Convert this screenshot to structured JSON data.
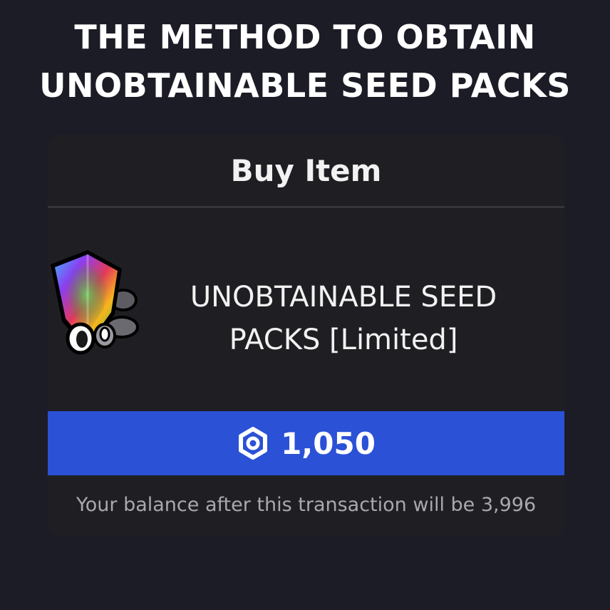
{
  "headline": {
    "line1": "THE METHOD TO OBTAIN",
    "line2": "UNOBTAINABLE SEED PACKS"
  },
  "modal": {
    "title": "Buy Item",
    "item": {
      "name_line1": "UNOBTAINABLE SEED",
      "name_line2": "PACKS [Limited]",
      "icon": "rainbow-shield-seed-pack-icon"
    },
    "buy_button": {
      "price": "1,050",
      "currency_icon": "robux-icon",
      "color": "#2a51d6"
    },
    "balance_text": "Your balance after this transaction will be  3,996"
  }
}
